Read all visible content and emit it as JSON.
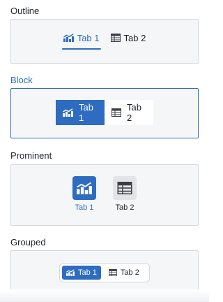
{
  "sections": {
    "outline": {
      "title": "Outline",
      "tabs": [
        {
          "label": "Tab 1",
          "icon": "chart-line-icon",
          "active": true
        },
        {
          "label": "Tab 2",
          "icon": "table-icon",
          "active": false
        }
      ]
    },
    "block": {
      "title": "Block",
      "tabs": [
        {
          "label": "Tab 1",
          "icon": "chart-line-icon",
          "active": true
        },
        {
          "label": "Tab 2",
          "icon": "table-icon",
          "active": false
        }
      ]
    },
    "prominent": {
      "title": "Prominent",
      "tabs": [
        {
          "label": "Tab 1",
          "icon": "chart-line-icon",
          "active": true
        },
        {
          "label": "Tab 2",
          "icon": "table-icon",
          "active": false
        }
      ]
    },
    "grouped": {
      "title": "Grouped",
      "tabs": [
        {
          "label": "Tab 1",
          "icon": "chart-line-icon",
          "active": true
        },
        {
          "label": "Tab 2",
          "icon": "table-icon",
          "active": false
        }
      ]
    }
  },
  "colors": {
    "accent": "#2d6cc0",
    "panel_bg": "#f5f6f8",
    "panel_border": "#d5d8dd",
    "text": "#1f2328"
  }
}
